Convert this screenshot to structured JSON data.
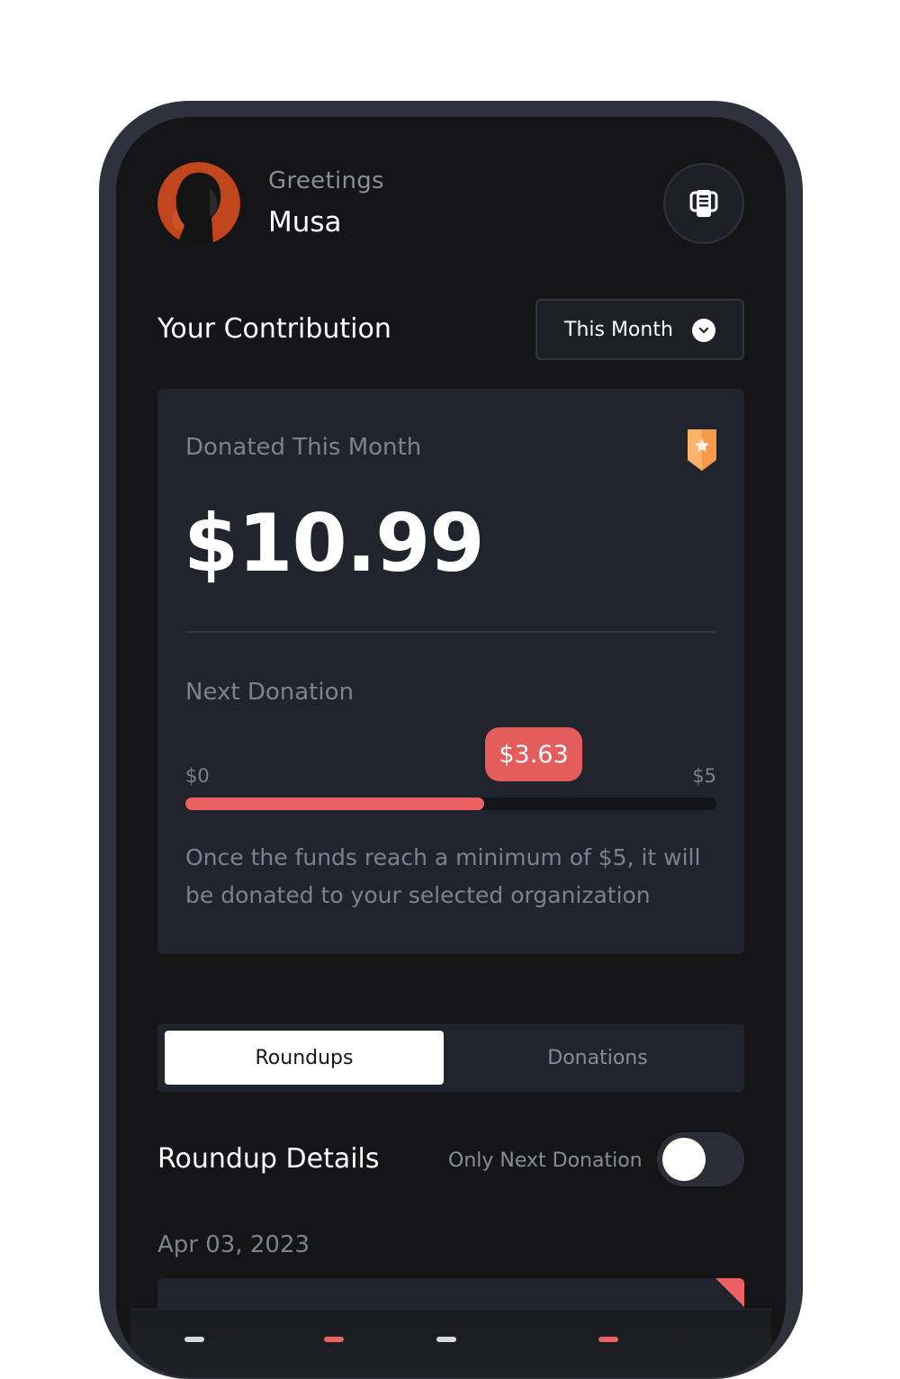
{
  "header": {
    "greeting": "Greetings",
    "user_name": "Musa"
  },
  "contribution": {
    "title": "Your Contribution",
    "period": "This Month"
  },
  "summary_card": {
    "donated_label": "Donated This Month",
    "donated_amount": "$10.99",
    "next_label": "Next Donation",
    "progress_current": "$3.63",
    "progress_min": "$0",
    "progress_max": "$5",
    "progress_fraction": 0.563,
    "note": "Once the funds reach a minimum of $5, it will be donated to your selected organization"
  },
  "tabs": [
    {
      "label": "Roundups",
      "active": true
    },
    {
      "label": "Donations",
      "active": false
    }
  ],
  "roundup_details": {
    "title": "Roundup Details",
    "toggle_label": "Only Next Donation",
    "toggle_on": false,
    "date": "Apr 03, 2023"
  },
  "colors": {
    "accent": "#ec6264",
    "badge": "#f79a4a",
    "background": "#151518",
    "card": "#22242d"
  },
  "icons": {
    "notification": "receipt-icon",
    "badge": "star-badge-icon",
    "dropdown": "chevron-down-icon"
  }
}
